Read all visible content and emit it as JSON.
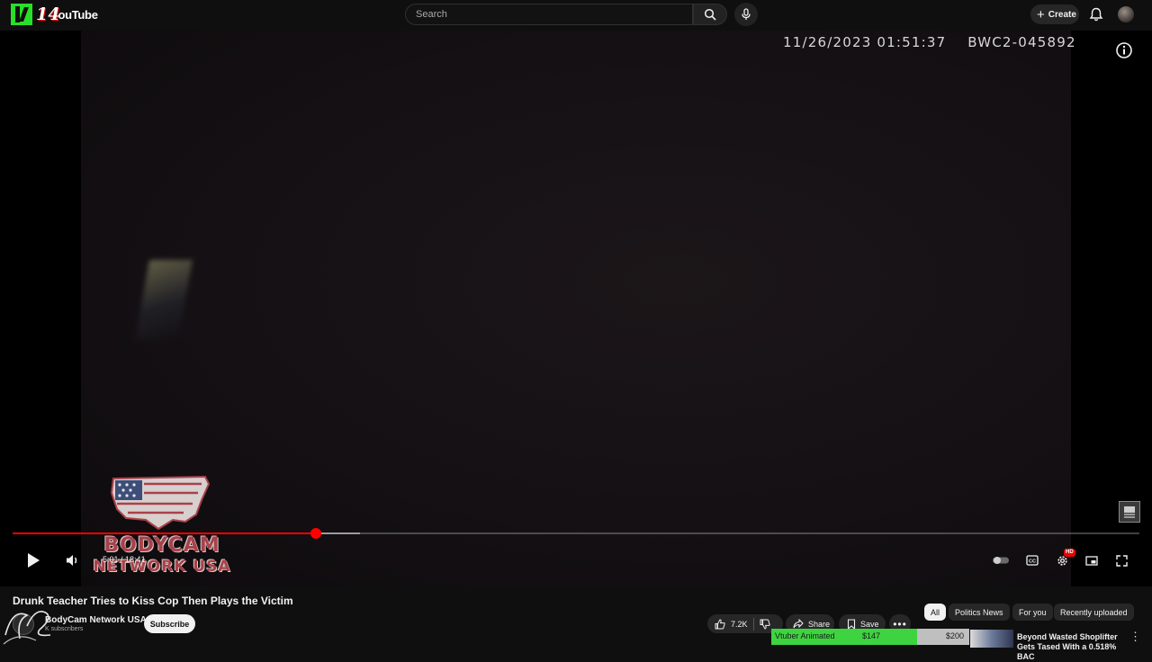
{
  "header": {
    "logo_number": "14",
    "logo_text": "ouTube",
    "search_placeholder": "Search",
    "create_label": "Create"
  },
  "player": {
    "overlay_timestamp": "11/26/2023 01:51:37    BWC2-045892",
    "time_current": "5:01",
    "time_separator": " / ",
    "time_total": "18:41",
    "played_fraction": 0.269,
    "buffered_fraction": 0.308,
    "quality_badge": "HD",
    "watermark_line1": "BODYCAM",
    "watermark_line2": "NETWORK USA"
  },
  "video": {
    "title": "Drunk Teacher Tries to Kiss Cop Then Plays the Victim",
    "channel_name": "BodyCam Network USA",
    "subscribers": "K subscribers",
    "subscribe_label": "Subscribe",
    "likes": "7.2K",
    "share_label": "Share",
    "save_label": "Save"
  },
  "filter_chips": [
    {
      "label": "All",
      "active": true
    },
    {
      "label": "Politics News",
      "active": false
    },
    {
      "label": "For you",
      "active": false
    },
    {
      "label": "Recently uploaded",
      "active": false
    }
  ],
  "donation_goal": {
    "label": "Vtuber Animated",
    "current": "$147",
    "target": "$200",
    "fraction": 0.735
  },
  "recommended": {
    "title": "Beyond Wasted Shoplifter Gets Tased With a 0.518% BAC"
  },
  "colors": {
    "accent_red": "#ff0000",
    "background": "#0f0f0f",
    "goal_green": "#3ed340"
  }
}
